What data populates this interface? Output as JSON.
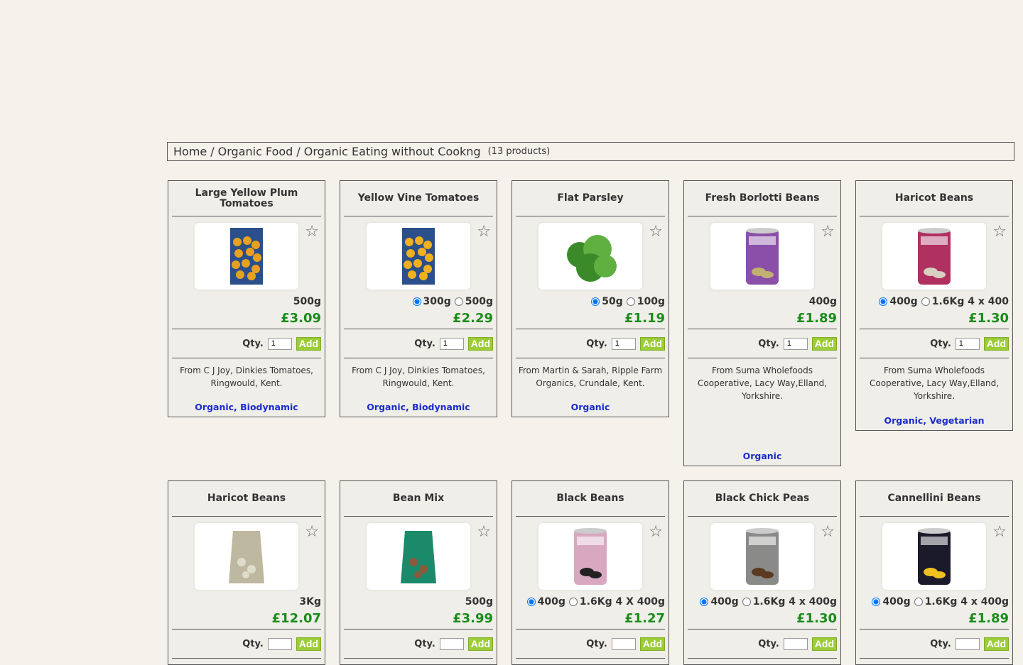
{
  "breadcrumb": {
    "home": "Home",
    "category": "Organic Food",
    "current": "Organic Eating without Cookng",
    "count": "(13 products)"
  },
  "qty_label": "Qty.",
  "add_label": "Add",
  "products": [
    {
      "title": "Large Yellow Plum Tomatoes",
      "sizes": [
        {
          "label": "500g",
          "radio": false
        }
      ],
      "price": "£3.09",
      "qty": "1",
      "supplier": "From C J Joy, Dinkies Tomatoes, Ringwould, Kent.",
      "tags": "Organic, Biodynamic"
    },
    {
      "title": "Yellow Vine Tomatoes",
      "sizes": [
        {
          "label": "300g",
          "radio": true,
          "checked": true
        },
        {
          "label": "500g",
          "radio": true,
          "checked": false
        }
      ],
      "price": "£2.29",
      "qty": "1",
      "supplier": "From C J Joy, Dinkies Tomatoes, Ringwould, Kent.",
      "tags": "Organic, Biodynamic"
    },
    {
      "title": "Flat Parsley",
      "sizes": [
        {
          "label": "50g",
          "radio": true,
          "checked": true
        },
        {
          "label": "100g",
          "radio": true,
          "checked": false
        }
      ],
      "price": "£1.19",
      "qty": "1",
      "supplier": "From Martin & Sarah, Ripple Farm Organics, Crundale, Kent.",
      "tags": "Organic"
    },
    {
      "title": "Fresh Borlotti Beans",
      "sizes": [
        {
          "label": "400g",
          "radio": false
        }
      ],
      "price": "£1.89",
      "qty": "1",
      "supplier": "From Suma Wholefoods Cooperative, Lacy Way,Elland, Yorkshire.",
      "tags": "Organic"
    },
    {
      "title": "Haricot Beans",
      "sizes": [
        {
          "label": "400g",
          "radio": true,
          "checked": true
        },
        {
          "label": "1.6Kg 4 x 400",
          "radio": true,
          "checked": false
        }
      ],
      "price": "£1.30",
      "qty": "1",
      "supplier": "From Suma Wholefoods Cooperative, Lacy Way,Elland, Yorkshire.",
      "tags": "Organic, Vegetarian"
    },
    {
      "title": "Haricot Beans",
      "sizes": [
        {
          "label": "3Kg",
          "radio": false
        }
      ],
      "price": "£12.07"
    },
    {
      "title": "Bean Mix",
      "sizes": [
        {
          "label": "500g",
          "radio": false
        }
      ],
      "price": "£3.99"
    },
    {
      "title": "Black Beans",
      "sizes": [
        {
          "label": "400g",
          "radio": true,
          "checked": true
        },
        {
          "label": "1.6Kg 4 X 400g",
          "radio": true,
          "checked": false
        }
      ],
      "price": "£1.27"
    },
    {
      "title": "Black Chick Peas",
      "sizes": [
        {
          "label": "400g",
          "radio": true,
          "checked": true
        },
        {
          "label": "1.6Kg 4 x 400g",
          "radio": true,
          "checked": false
        }
      ],
      "price": "£1.30"
    },
    {
      "title": "Cannellini Beans",
      "sizes": [
        {
          "label": "400g",
          "radio": true,
          "checked": true
        },
        {
          "label": "1.6Kg 4 x 400g",
          "radio": true,
          "checked": false
        }
      ],
      "price": "£1.89"
    }
  ],
  "images": [
    {
      "icon": "yellow-plum-tomatoes-image",
      "colors": [
        "#2a4f8a",
        "#e8a020"
      ]
    },
    {
      "icon": "yellow-vine-tomatoes-image",
      "colors": [
        "#2a4f8a",
        "#f0b020"
      ]
    },
    {
      "icon": "flat-parsley-image",
      "colors": [
        "#3a8a2a",
        "#5fb040"
      ]
    },
    {
      "icon": "borlotti-beans-can-image",
      "colors": [
        "#8a4fa8",
        "#c2b070"
      ]
    },
    {
      "icon": "haricot-beans-can-image",
      "colors": [
        "#b03060",
        "#d8d0c0"
      ]
    },
    {
      "icon": "haricot-beans-bag-image",
      "colors": [
        "#bfb8a0",
        "#e0dccc"
      ]
    },
    {
      "icon": "bean-mix-bag-image",
      "colors": [
        "#1a8a6a",
        "#8a5a3a"
      ]
    },
    {
      "icon": "black-beans-can-image",
      "colors": [
        "#d8a8c0",
        "#222222"
      ]
    },
    {
      "icon": "black-chick-peas-can-image",
      "colors": [
        "#8a8a88",
        "#5a3a20"
      ]
    },
    {
      "icon": "cannellini-beans-can-image",
      "colors": [
        "#1a1a2a",
        "#f0c020"
      ]
    }
  ]
}
